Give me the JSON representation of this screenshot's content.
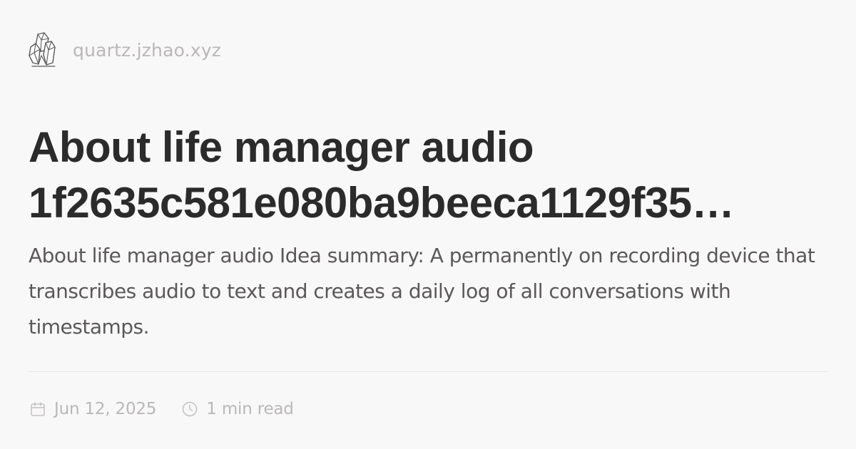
{
  "site": {
    "logo_icon": "crystal-icon",
    "domain": "quartz.jzhao.xyz"
  },
  "page": {
    "title": "About life manager audio\n1f2635c581e080ba9beeca1129f35…",
    "description": "About life manager audio Idea summary: A permanently on recording device that transcribes audio to text and creates a daily log of all conversations with timestamps."
  },
  "meta": {
    "date_icon": "calendar-icon",
    "date": "Jun 12, 2025",
    "read_time_icon": "clock-icon",
    "read_time": "1 min read"
  },
  "colors": {
    "background": "#f9f8f8",
    "title": "#2b2b2b",
    "body_text": "#5a5858",
    "muted": "#b9b7b7",
    "divider": "#e7e5e5"
  }
}
